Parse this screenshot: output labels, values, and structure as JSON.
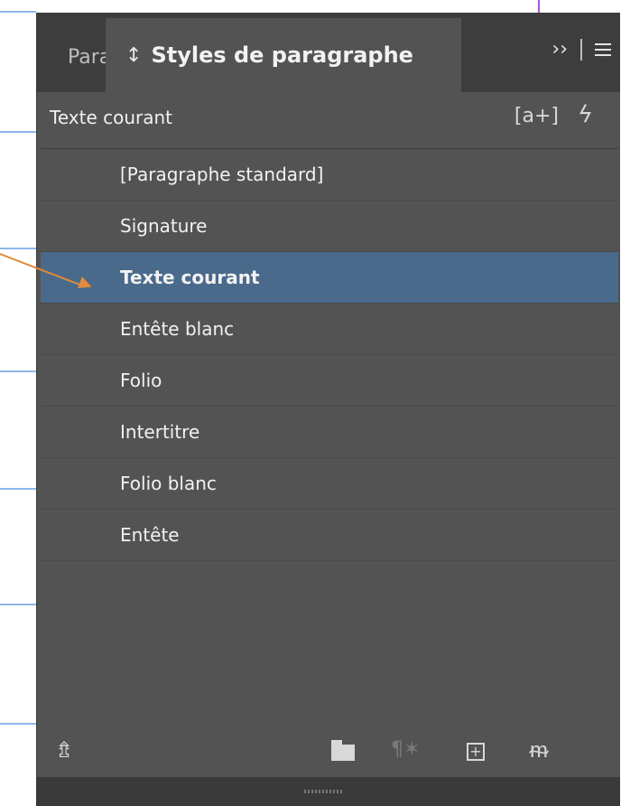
{
  "panel": {
    "inactive_tab": "Paragraphe",
    "active_tab": "Styles de paragraphe",
    "sort_icon": "↕",
    "expand_icon": "››",
    "current_style": "Texte courant",
    "new_style_from_selection": "[a+]",
    "flash_icon": "ϟ"
  },
  "styles": [
    {
      "label": "[Paragraphe standard]",
      "selected": false
    },
    {
      "label": "Signature",
      "selected": false
    },
    {
      "label": "Texte courant",
      "selected": true
    },
    {
      "label": "Entête blanc",
      "selected": false
    },
    {
      "label": "Folio",
      "selected": false
    },
    {
      "label": "Intertitre",
      "selected": false
    },
    {
      "label": "Folio blanc",
      "selected": false
    },
    {
      "label": "Entête",
      "selected": false
    }
  ],
  "footer": {
    "import_icon": "⇯",
    "clear_icon": "¶✶",
    "new_icon": "+",
    "delete_icon": "ᵯ"
  },
  "colors": {
    "panel_bg": "#535353",
    "selected_row": "#4a6a8c",
    "annotation_arrow": "#e08a3c"
  }
}
